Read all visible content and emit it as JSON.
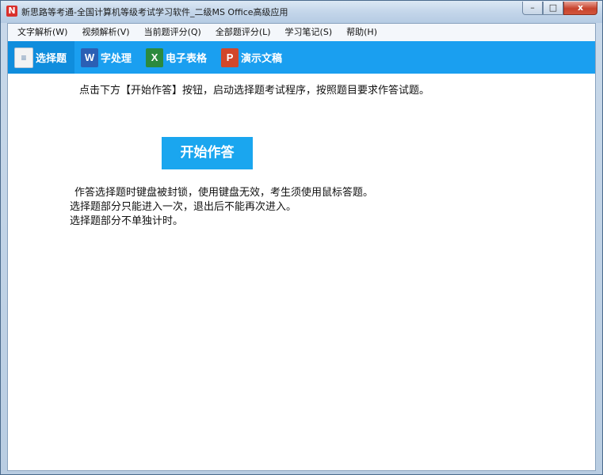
{
  "window": {
    "title": "新思路等考通-全国计算机等级考试学习软件_二级MS Office高级应用",
    "app_icon": "N",
    "minimize": "–",
    "maximize": "□",
    "close": "x"
  },
  "menu": [
    {
      "label": "文字解析(W)"
    },
    {
      "label": "视频解析(V)"
    },
    {
      "label": "当前题评分(Q)"
    },
    {
      "label": "全部题评分(L)"
    },
    {
      "label": "学习笔记(S)"
    },
    {
      "label": "帮助(H)"
    }
  ],
  "tabs": [
    {
      "label": "选择题",
      "icon": "choice-icon",
      "glyph": "≡"
    },
    {
      "label": "字处理",
      "icon": "word-icon",
      "glyph": "W"
    },
    {
      "label": "电子表格",
      "icon": "excel-icon",
      "glyph": "X"
    },
    {
      "label": "演示文稿",
      "icon": "ppt-icon",
      "glyph": "P"
    }
  ],
  "main": {
    "instruction": "点击下方【开始作答】按钮，启动选择题考试程序，按照题目要求作答试题。",
    "start_button": "开始作答",
    "notes": [
      "作答选择题时键盘被封锁，使用键盘无效，考生须使用鼠标答题。",
      "选择题部分只能进入一次，退出后不能再次进入。",
      "选择题部分不单独计时。"
    ]
  },
  "colors": {
    "tab_bar": "#1a9ff0",
    "start_button": "#1aa6ef"
  }
}
